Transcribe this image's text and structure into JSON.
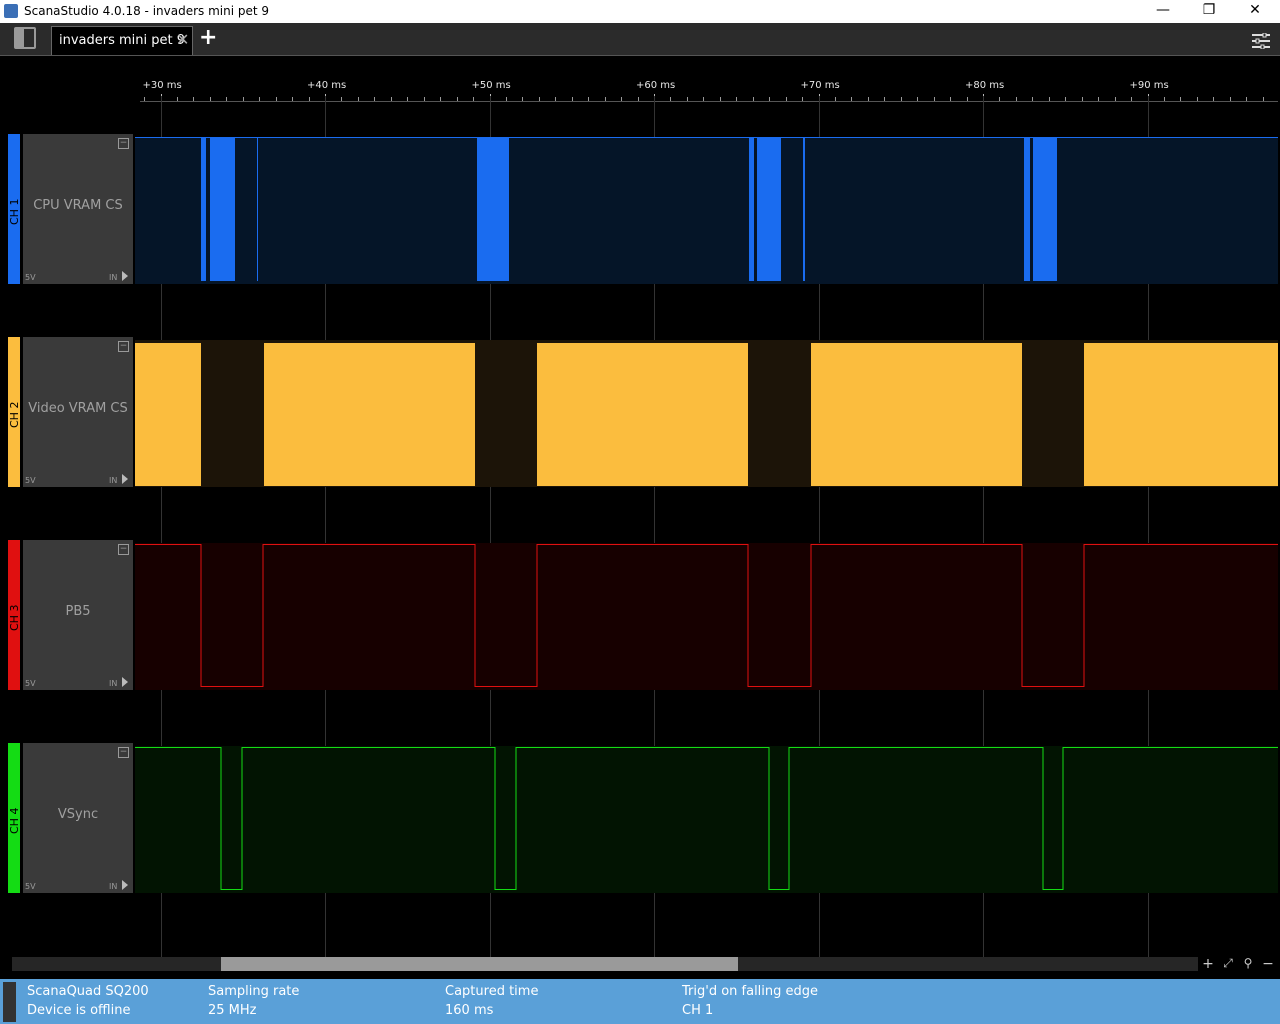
{
  "window": {
    "title": "ScanaStudio 4.0.18 - invaders mini pet 9",
    "minimize_glyph": "—",
    "restore_glyph": "❐",
    "close_glyph": "✕"
  },
  "tabs": {
    "active_label": "invaders mini pet 9",
    "close_glyph": "✕",
    "add_glyph": "+"
  },
  "ruler": {
    "labels": [
      "+30 ms",
      "+40 ms",
      "+50 ms",
      "+60 ms",
      "+70 ms",
      "+80 ms",
      "+90 ms"
    ]
  },
  "channels": [
    {
      "id": "CH 1",
      "name": "CPU VRAM CS",
      "volt": "5V",
      "io": "IN",
      "color": "#1a6cf0",
      "bg": "#051528"
    },
    {
      "id": "CH 2",
      "name": "Video VRAM CS",
      "volt": "5V",
      "io": "IN",
      "color": "#fbbd3e",
      "bg": "#1c1408"
    },
    {
      "id": "CH 3",
      "name": "PB5",
      "volt": "5V",
      "io": "IN",
      "color": "#e01010",
      "bg": "#170000"
    },
    {
      "id": "CH 4",
      "name": "VSync",
      "volt": "5V",
      "io": "IN",
      "color": "#14dc14",
      "bg": "#021402"
    }
  ],
  "scrollbar": {
    "visible_fraction_start": 0.176,
    "visible_fraction_end": 0.612
  },
  "zoom_controls": [
    "zoom-in-icon",
    "fit-icon",
    "search-icon",
    "zoom-out-icon"
  ],
  "status": {
    "device_name": "ScanaQuad SQ200",
    "device_state": "Device is offline",
    "sampling_label": "Sampling rate",
    "sampling_value": "25 MHz",
    "captured_label": "Captured time",
    "captured_value": "160 ms",
    "trigger_label": "Trig'd on falling edge",
    "trigger_value": "CH 1"
  }
}
